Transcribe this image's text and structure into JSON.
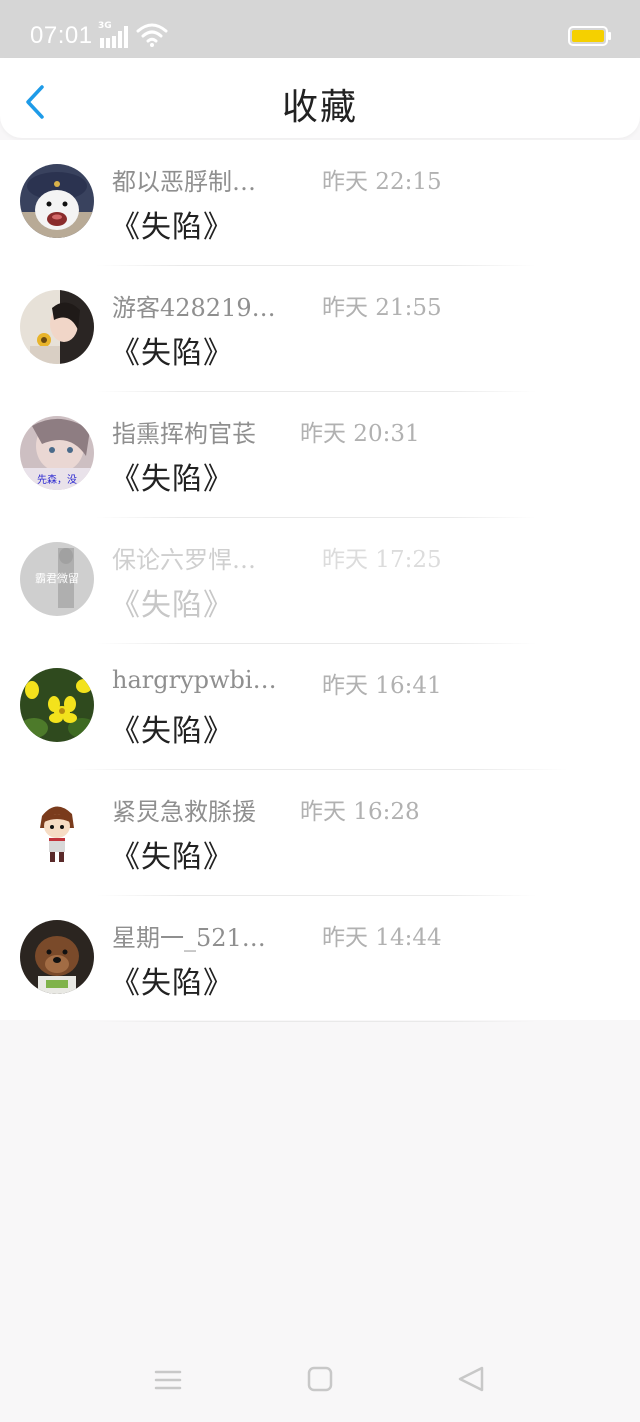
{
  "status_bar": {
    "time": "07:01",
    "network": "3G",
    "icons": [
      "signal-icon",
      "wifi-icon",
      "battery-icon"
    ],
    "battery_color": "#f5d000"
  },
  "header": {
    "title": "收藏",
    "back_icon": "chevron-left-icon",
    "accent_color": "#1e9be8"
  },
  "items": [
    {
      "user": "都以恶脬制…",
      "time": "昨天 22:15",
      "book": "《失陷》"
    },
    {
      "user": "游客428219…",
      "time": "昨天 21:55",
      "book": "《失陷》"
    },
    {
      "user": "指熏挥枸官苌",
      "time": "昨天 20:31",
      "book": "《失陷》",
      "avatar_text": "先森，没"
    },
    {
      "user": "保论六罗悍…",
      "time": "昨天 17:25",
      "book": "《失陷》",
      "avatar_text": "霸君微留"
    },
    {
      "user": "hargrypwbi…",
      "time": "昨天 16:41",
      "book": "《失陷》"
    },
    {
      "user": "紧炅急救脎援",
      "time": "昨天 16:28",
      "book": "《失陷》"
    },
    {
      "user": "星期一_521…",
      "time": "昨天 14:44",
      "book": "《失陷》"
    }
  ],
  "bottom_nav": {
    "icons": [
      "menu-icon",
      "home-square-icon",
      "back-triangle-icon"
    ]
  }
}
